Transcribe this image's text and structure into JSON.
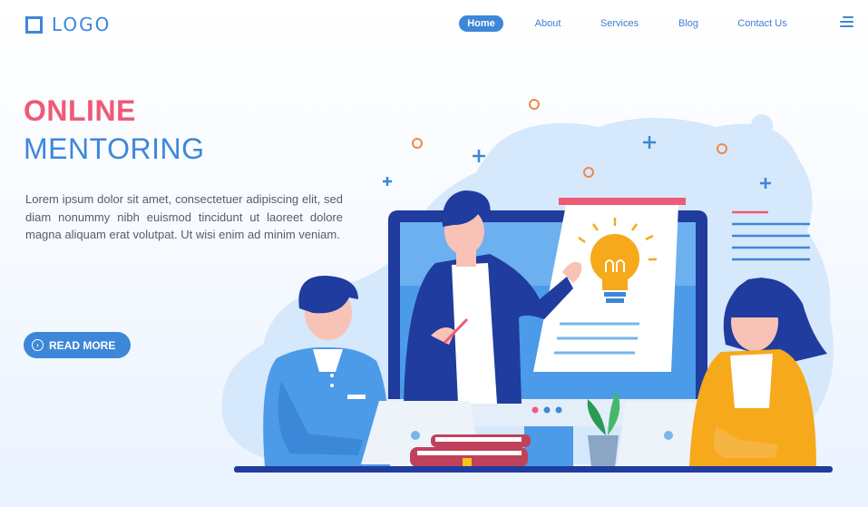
{
  "header": {
    "logo_text": "LOGO",
    "nav": [
      {
        "label": "Home",
        "active": true
      },
      {
        "label": "About",
        "active": false
      },
      {
        "label": "Services",
        "active": false
      },
      {
        "label": "Blog",
        "active": false
      },
      {
        "label": "Contact Us",
        "active": false
      }
    ]
  },
  "hero": {
    "title_line1": "ONLINE",
    "title_line2": "MENTORING",
    "description": "Lorem ipsum dolor sit amet, consectetuer adipiscing elit, sed diam nonummy nibh euismod tincidunt ut laoreet dolore magna aliquam erat volutpat. Ut wisi enim ad minim veniam.",
    "cta_label": "READ MORE"
  },
  "colors": {
    "primary": "#3d87d9",
    "accent": "#ef5a78",
    "text": "#5a5a6a",
    "dark_blue": "#1f3c9e",
    "orange": "#f6a91a"
  },
  "icons": [
    "logo-square-icon",
    "hamburger-menu-icon",
    "arrow-circle-icon"
  ]
}
